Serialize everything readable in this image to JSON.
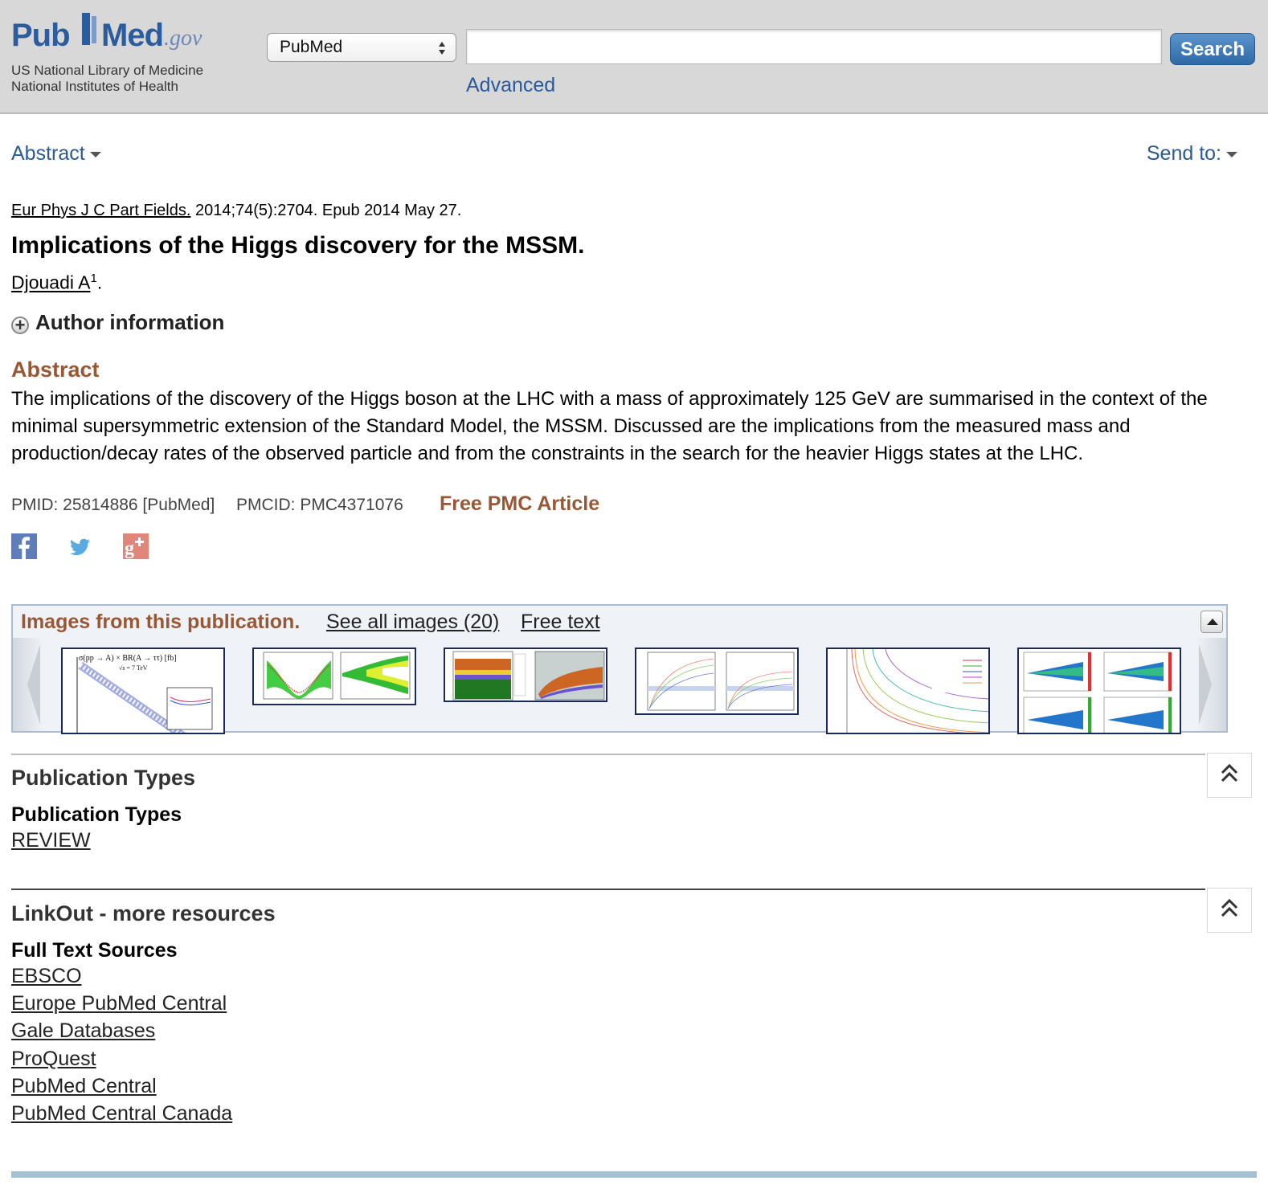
{
  "header": {
    "logo_pub": "Pub",
    "logo_med": "Med",
    "logo_gov": ".gov",
    "nlm_line1": "US National Library of Medicine",
    "nlm_line2": "National Institutes of Health",
    "database_selected": "PubMed",
    "search_value": "",
    "search_button": "Search",
    "advanced_link": "Advanced"
  },
  "toolbar": {
    "format_dropdown": "Abstract",
    "send_to": "Send to:"
  },
  "citation": {
    "journal": "Eur Phys J C Part Fields.",
    "details": " 2014;74(5):2704. Epub 2014 May 27."
  },
  "article": {
    "title": "Implications of the Higgs discovery for the MSSM.",
    "author": "Djouadi A",
    "author_sup": "1",
    "author_suffix": ".",
    "author_info": "Author information",
    "abstract_heading": "Abstract",
    "abstract_text": "The implications of the discovery of the Higgs boson at the LHC with a mass of approximately 125 GeV are summarised in the context of the minimal supersymmetric extension of the Standard Model, the MSSM. Discussed are the implications from the measured mass and production/decay rates of the observed particle and from the constraints in the search for the heavier Higgs states at the LHC.",
    "pmid": "PMID: 25814886 [PubMed]",
    "pmcid": "PMCID: PMC4371076",
    "free_pmc": "Free PMC Article"
  },
  "social": [
    "facebook-icon",
    "twitter-icon",
    "google-plus-icon"
  ],
  "images_strip": {
    "title": "Images from this publication.",
    "see_all": "See all images (20)",
    "free_text": "Free text",
    "thumb_label_1": "σ(pp → A) × BR(A → ττ) [fb]",
    "thumb_label_1b": "√s = 7 TeV"
  },
  "publication_types": {
    "heading": "Publication Types",
    "subheading": "Publication Types",
    "items": [
      "REVIEW"
    ]
  },
  "linkout": {
    "heading": "LinkOut - more resources",
    "subheading": "Full Text Sources",
    "items": [
      "EBSCO",
      "Europe PubMed Central",
      "Gale Databases",
      "ProQuest",
      "PubMed Central",
      "PubMed Central Canada"
    ]
  },
  "colors": {
    "link_blue": "#2a5a98",
    "accent_brown": "#985735",
    "header_gray": "#d8d8d8"
  }
}
